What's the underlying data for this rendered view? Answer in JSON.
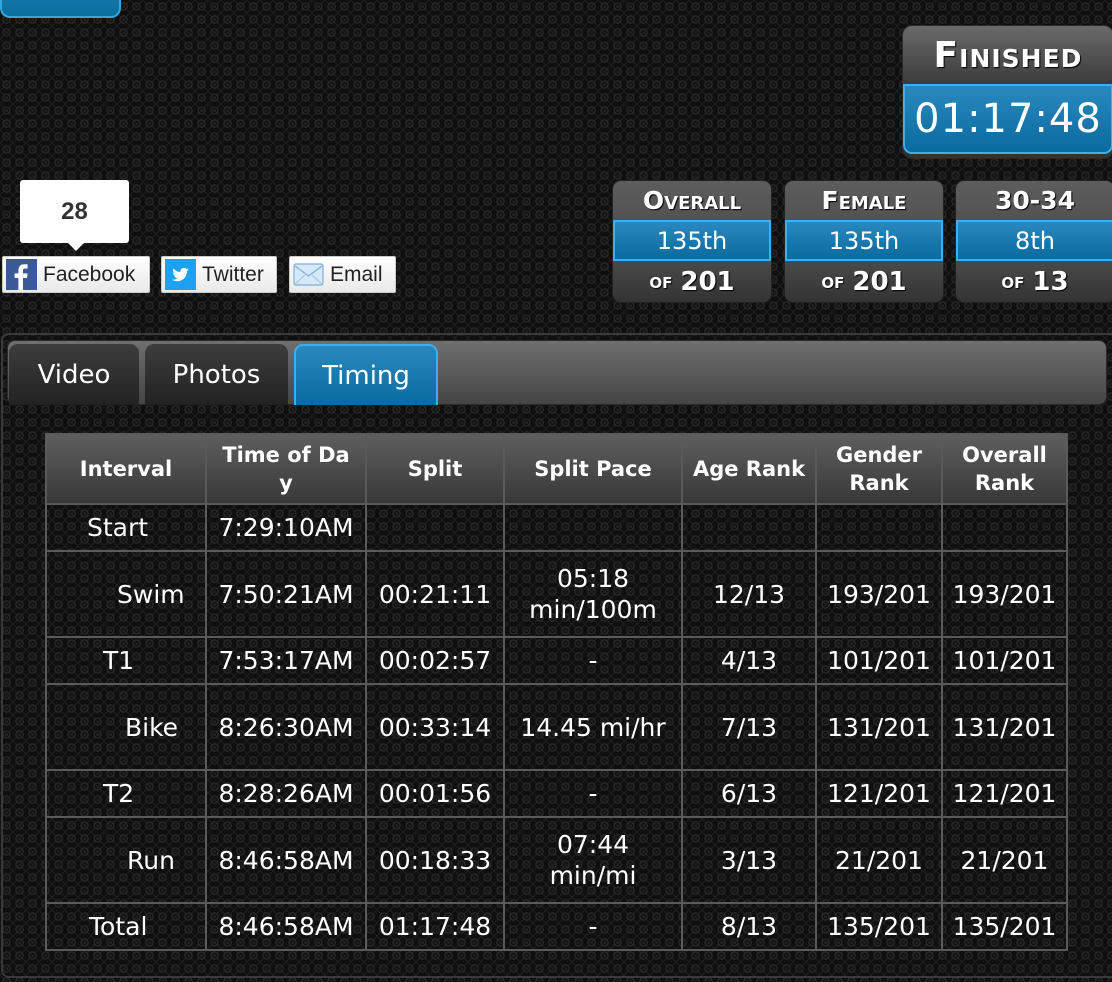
{
  "finished": {
    "label": "Finished",
    "time": "01:17:48"
  },
  "share": {
    "count": "28",
    "buttons": [
      {
        "label": "Facebook",
        "icon": "facebook-icon"
      },
      {
        "label": "Twitter",
        "icon": "twitter-icon"
      },
      {
        "label": "Email",
        "icon": "email-icon"
      }
    ]
  },
  "ranks": [
    {
      "label": "Overall",
      "value": "135th",
      "of_label": "of",
      "of_value": "201"
    },
    {
      "label": "Female",
      "value": "135th",
      "of_label": "of",
      "of_value": "201"
    },
    {
      "label": "30-34",
      "value": "8th",
      "of_label": "of",
      "of_value": "13"
    }
  ],
  "tabs": [
    {
      "label": "Video",
      "active": false
    },
    {
      "label": "Photos",
      "active": false
    },
    {
      "label": "Timing",
      "active": true
    }
  ],
  "table": {
    "headers": [
      "Interval",
      "Time of Day",
      "Split",
      "Split Pace",
      "Age Rank",
      "Gender Rank",
      "Overall Rank"
    ],
    "header_display": [
      "Interval",
      "Time of Da y",
      "Split",
      "Split Pace",
      "Age Rank",
      "Gender Rank",
      "Overall Rank"
    ],
    "rows": [
      {
        "interval": "Start",
        "time_of_day": "7:29:10AM",
        "split": "",
        "pace": "",
        "age_rank": "",
        "gender_rank": "",
        "overall_rank": ""
      },
      {
        "interval": "Swim",
        "time_of_day": "7:50:21AM",
        "split": "00:21:11",
        "pace": "05:18 min/100m",
        "age_rank": "12/13",
        "gender_rank": "193/201",
        "overall_rank": "193/201"
      },
      {
        "interval": "T1",
        "time_of_day": "7:53:17AM",
        "split": "00:02:57",
        "pace": "-",
        "age_rank": "4/13",
        "gender_rank": "101/201",
        "overall_rank": "101/201"
      },
      {
        "interval": "Bike",
        "time_of_day": "8:26:30AM",
        "split": "00:33:14",
        "pace": "14.45 mi/hr",
        "age_rank": "7/13",
        "gender_rank": "131/201",
        "overall_rank": "131/201"
      },
      {
        "interval": "T2",
        "time_of_day": "8:28:26AM",
        "split": "00:01:56",
        "pace": "-",
        "age_rank": "6/13",
        "gender_rank": "121/201",
        "overall_rank": "121/201"
      },
      {
        "interval": "Run",
        "time_of_day": "8:46:58AM",
        "split": "00:18:33",
        "pace": "07:44 min/mi",
        "age_rank": "3/13",
        "gender_rank": "21/201",
        "overall_rank": "21/201"
      },
      {
        "interval": "Total",
        "time_of_day": "8:46:58AM",
        "split": "01:17:48",
        "pace": "-",
        "age_rank": "8/13",
        "gender_rank": "135/201",
        "overall_rank": "135/201"
      }
    ]
  },
  "colors": {
    "accent_blue": "#0a6b9e",
    "accent_border": "#3ab0ee",
    "facebook_blue": "#3b5998",
    "twitter_blue": "#1da1f2"
  }
}
